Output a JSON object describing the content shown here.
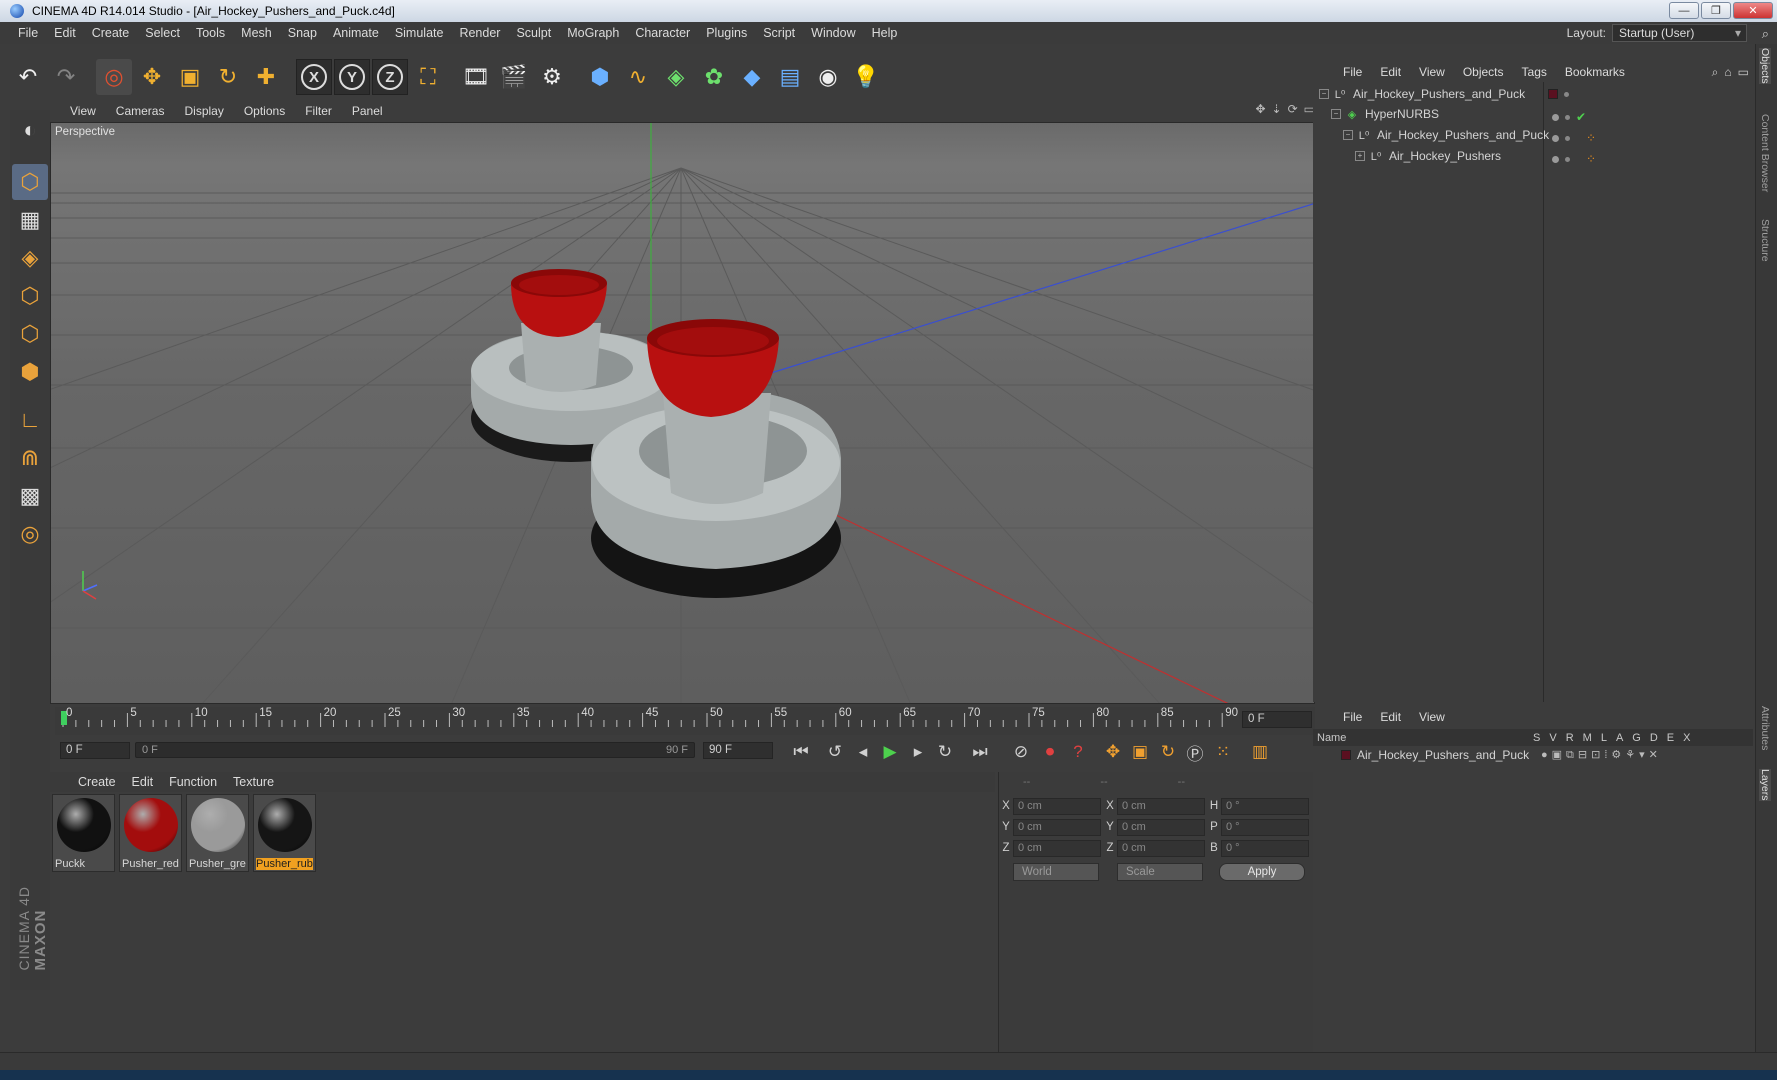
{
  "window": {
    "title": "CINEMA 4D R14.014 Studio - [Air_Hockey_Pushers_and_Puck.c4d]"
  },
  "menu": [
    "File",
    "Edit",
    "Create",
    "Select",
    "Tools",
    "Mesh",
    "Snap",
    "Animate",
    "Simulate",
    "Render",
    "Sculpt",
    "MoGraph",
    "Character",
    "Plugins",
    "Script",
    "Window",
    "Help"
  ],
  "layout": {
    "label": "Layout:",
    "value": "Startup (User)"
  },
  "viewport": {
    "menu": [
      "View",
      "Cameras",
      "Display",
      "Options",
      "Filter",
      "Panel"
    ],
    "label": "Perspective"
  },
  "timeline": {
    "ticks": [
      "0",
      "5",
      "10",
      "15",
      "20",
      "25",
      "30",
      "35",
      "40",
      "45",
      "50",
      "55",
      "60",
      "65",
      "70",
      "75",
      "80",
      "85",
      "90"
    ],
    "current_frame": "0 F",
    "start_field": "0 F",
    "slider_start": "0 F",
    "slider_end": "90 F",
    "end_field": "90 F"
  },
  "materials": {
    "menu": [
      "Create",
      "Edit",
      "Function",
      "Texture"
    ],
    "items": [
      {
        "name": "Puckk",
        "color": "#111111"
      },
      {
        "name": "Pusher_red",
        "color": "#a30d0d"
      },
      {
        "name": "Pusher_gre",
        "color": "#9a9a9a"
      },
      {
        "name": "Pusher_rub",
        "color": "#151515"
      }
    ]
  },
  "coords": {
    "header": [
      "--",
      "--",
      "--"
    ],
    "rows": [
      {
        "a": "X",
        "av": "0 cm",
        "b": "X",
        "bv": "0 cm",
        "c": "H",
        "cv": "0 °"
      },
      {
        "a": "Y",
        "av": "0 cm",
        "b": "Y",
        "bv": "0 cm",
        "c": "P",
        "cv": "0 °"
      },
      {
        "a": "Z",
        "av": "0 cm",
        "b": "Z",
        "bv": "0 cm",
        "c": "B",
        "cv": "0 °"
      }
    ],
    "mode": "World",
    "type": "Scale",
    "apply": "Apply"
  },
  "objects": {
    "menu": [
      "File",
      "Edit",
      "View",
      "Objects",
      "Tags",
      "Bookmarks"
    ],
    "tree": [
      {
        "label": "Air_Hockey_Pushers_and_Puck",
        "icon": "null-object-icon"
      },
      {
        "label": "HyperNURBS",
        "icon": "hypernurbs-icon"
      },
      {
        "label": "Air_Hockey_Pushers_and_Puck",
        "icon": "null-object-icon"
      },
      {
        "label": "Air_Hockey_Pushers",
        "icon": "null-object-icon"
      }
    ]
  },
  "layers": {
    "menu": [
      "File",
      "Edit",
      "View"
    ],
    "columns": [
      "S",
      "V",
      "R",
      "M",
      "L",
      "A",
      "G",
      "D",
      "E",
      "X"
    ],
    "name_header": "Name",
    "rows": [
      {
        "name": "Air_Hockey_Pushers_and_Puck",
        "color": "#5a1020"
      }
    ]
  },
  "sidebar_tabs": [
    "Objects",
    "Content Browser",
    "Structure",
    "Attributes",
    "Layers"
  ],
  "brand": {
    "line1": "MAXON",
    "line2": "CINEMA 4D"
  }
}
